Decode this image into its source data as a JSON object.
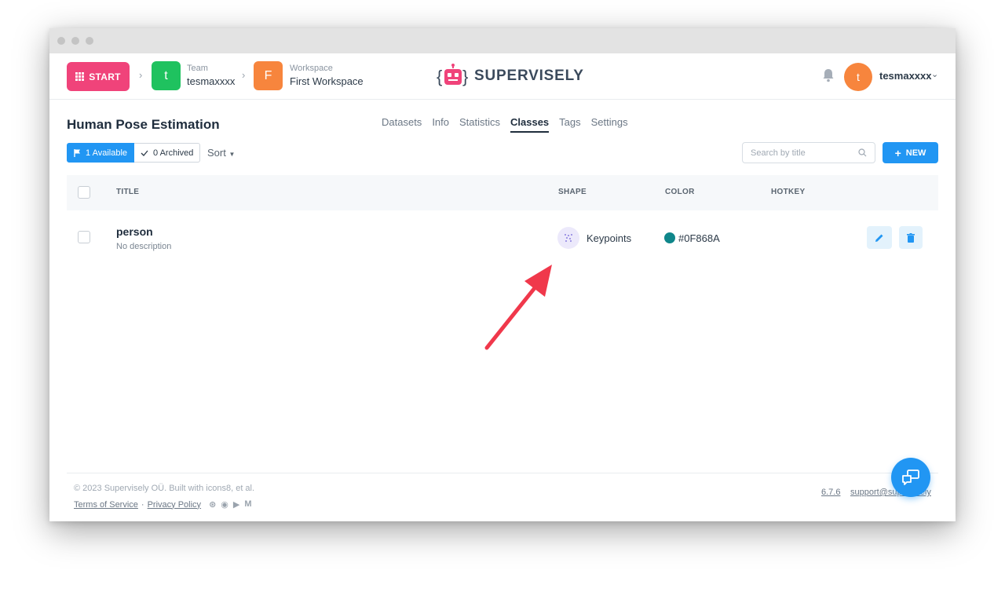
{
  "header": {
    "start_label": "START",
    "team_label": "Team",
    "team_value": "tesmaxxxx",
    "team_initial": "t",
    "team_color": "#1fc25f",
    "workspace_label": "Workspace",
    "workspace_value": "First Workspace",
    "workspace_initial": "F",
    "workspace_color": "#f7853d",
    "logo_text": "SUPERVISELY",
    "user_initial": "t",
    "user_name": "tesmaxxxx"
  },
  "page": {
    "title": "Human Pose Estimation",
    "tabs": [
      {
        "label": "Datasets"
      },
      {
        "label": "Info"
      },
      {
        "label": "Statistics"
      },
      {
        "label": "Classes"
      },
      {
        "label": "Tags"
      },
      {
        "label": "Settings"
      }
    ],
    "active_tab": "Classes"
  },
  "toolbar": {
    "available_label": "1 Available",
    "archived_label": "0 Archived",
    "sort_label": "Sort",
    "search_placeholder": "Search by title",
    "new_label": "NEW"
  },
  "table": {
    "columns": [
      "TITLE",
      "SHAPE",
      "COLOR",
      "HOTKEY"
    ],
    "rows": [
      {
        "title": "person",
        "description": "No description",
        "shape": "Keypoints",
        "color_label": "#0F868A",
        "color": "#0F868A",
        "hotkey": ""
      }
    ]
  },
  "footer": {
    "copyright": "© 2023 Supervisely OÜ. Built with icons8, et al.",
    "terms": "Terms of Service",
    "privacy": "Privacy Policy",
    "version": "6.7.6",
    "support": "support@supervisely"
  },
  "colors": {
    "start": "#f0437a",
    "primary": "#2196f3",
    "annotation_arrow": "#f0384b"
  }
}
